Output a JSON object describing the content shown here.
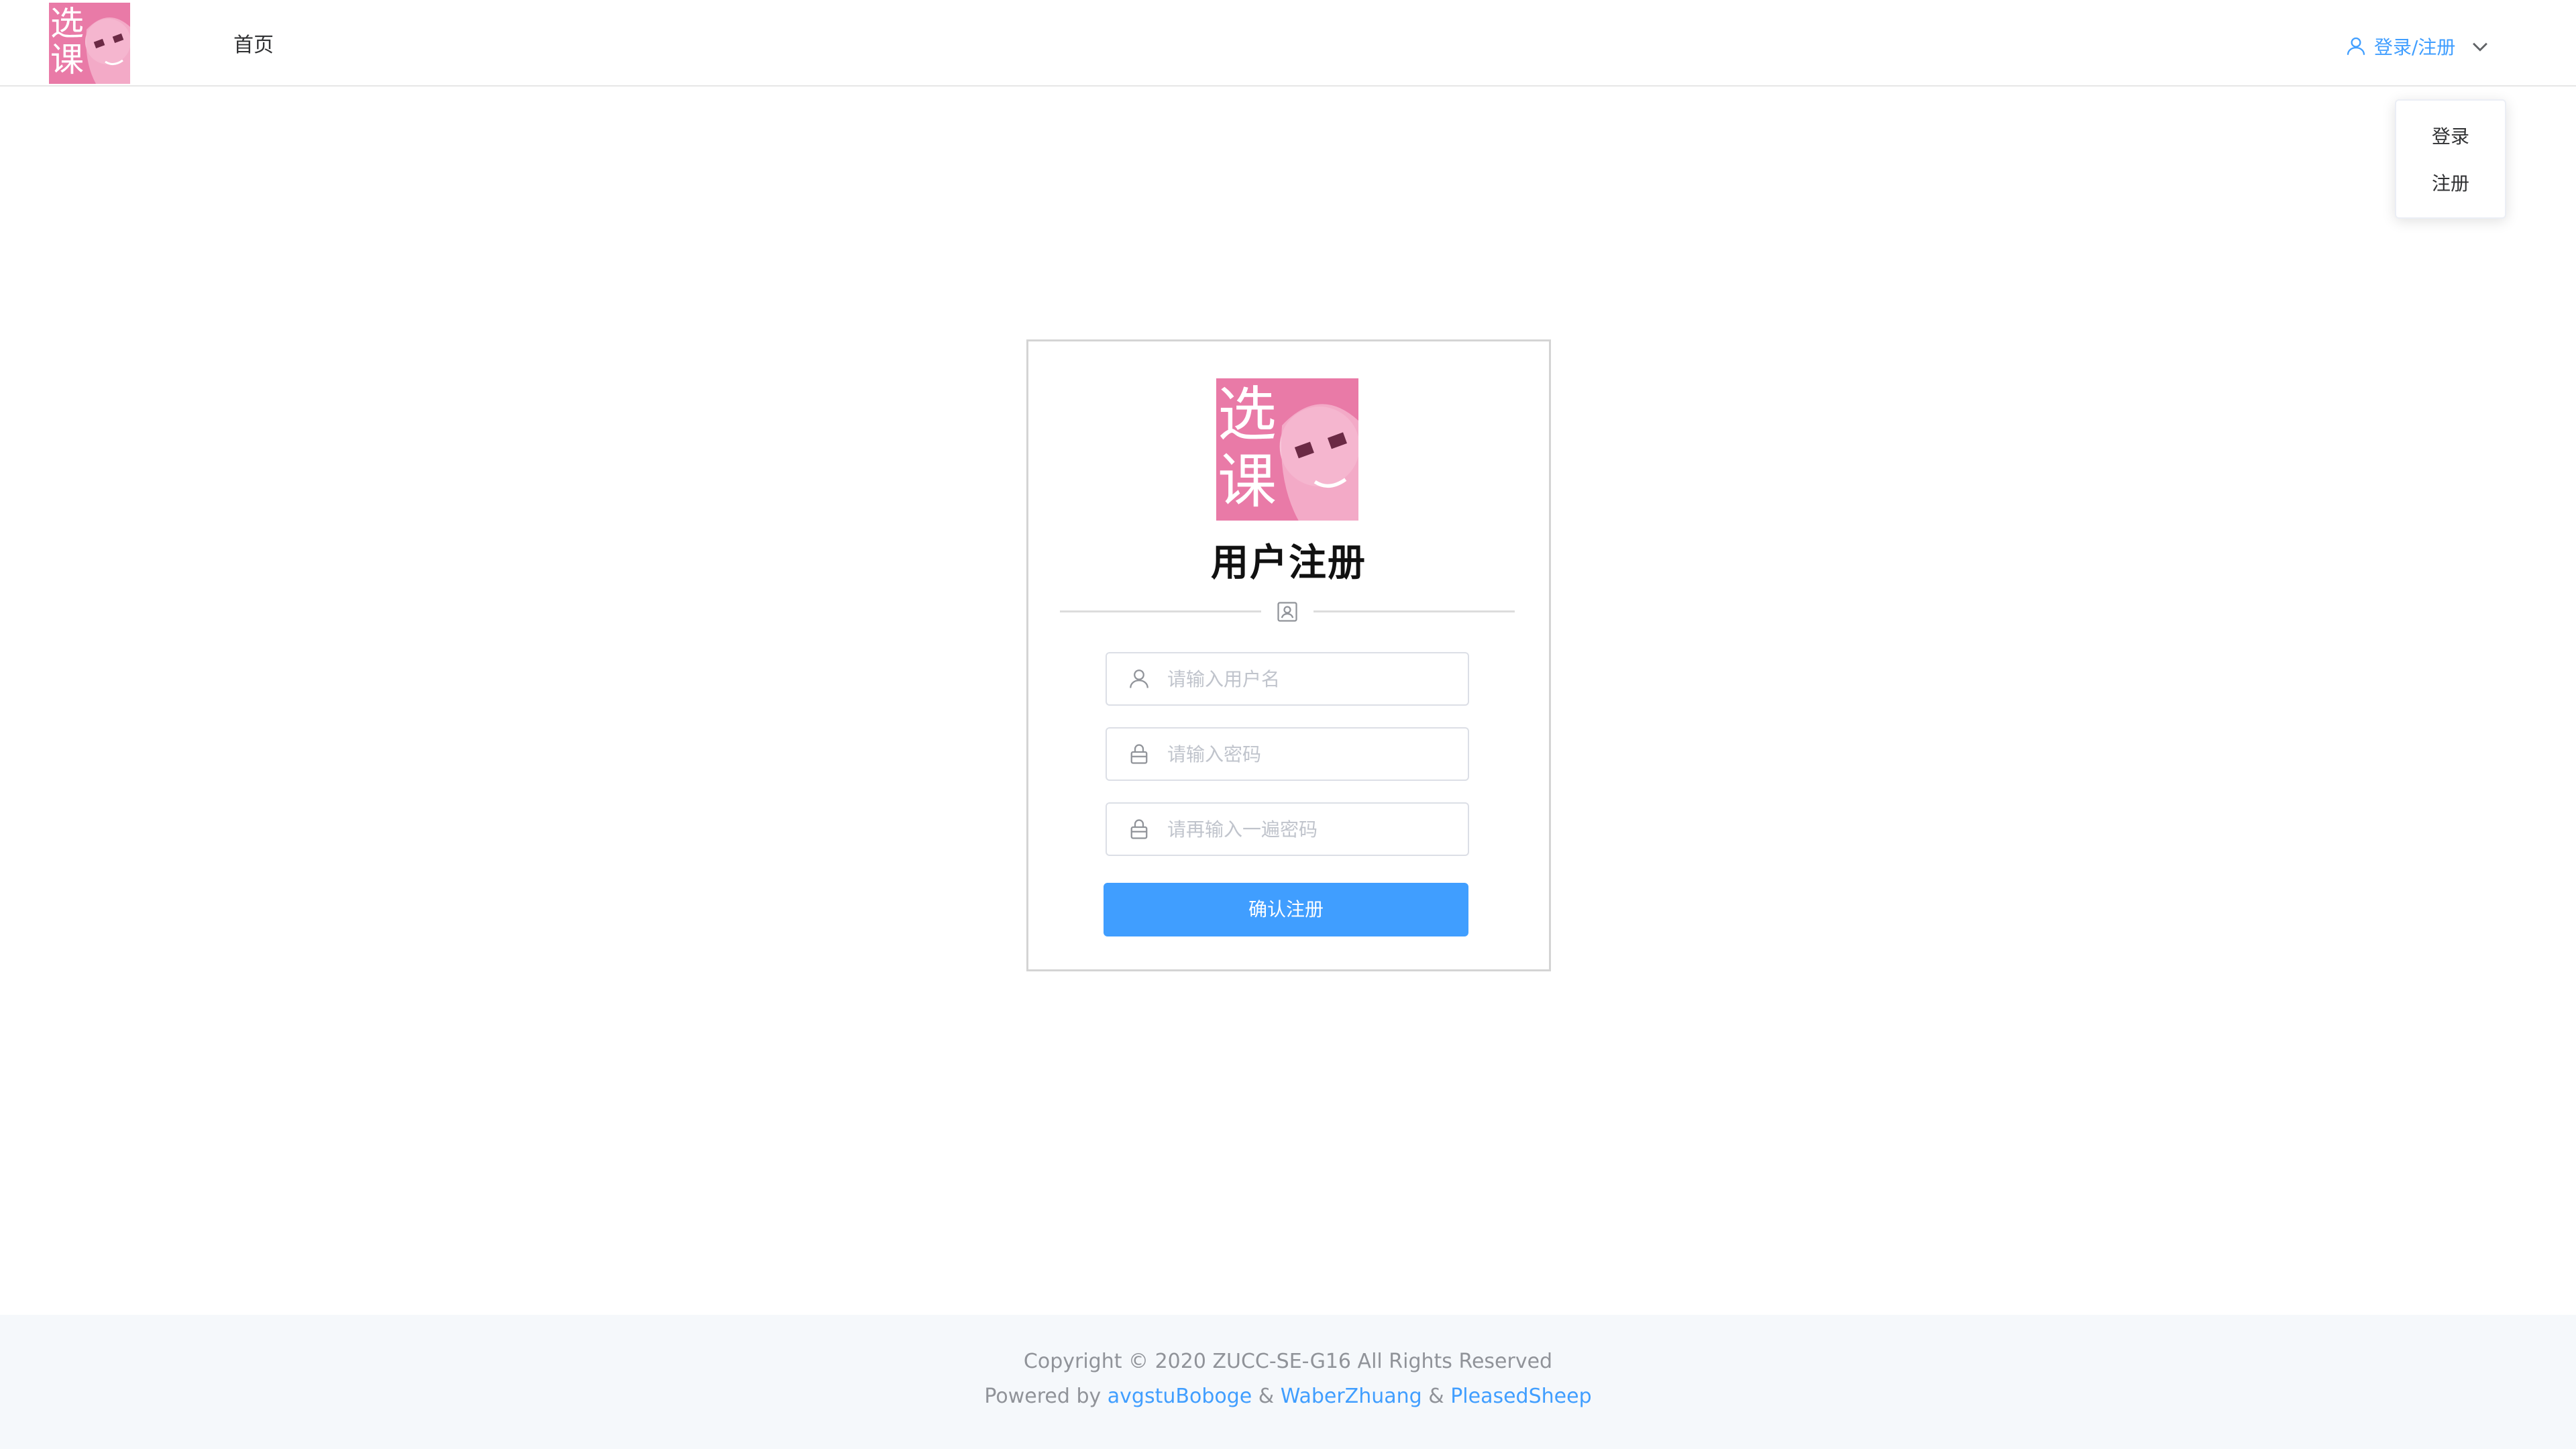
{
  "header": {
    "logo_chars": [
      "选",
      "课"
    ],
    "nav_home": "首页",
    "user_menu_label": "登录/注册",
    "accent_color": "#409eff"
  },
  "dropdown": {
    "items": [
      "登录",
      "注册"
    ]
  },
  "register": {
    "logo_chars": [
      "选",
      "课"
    ],
    "title": "用户注册",
    "username_placeholder": "请输入用户名",
    "password_placeholder": "请输入密码",
    "confirm_placeholder": "请再输入一遍密码",
    "submit_label": "确认注册",
    "icons": [
      "user-icon",
      "lock-icon",
      "lock-icon",
      "id-card-icon"
    ]
  },
  "footer": {
    "copyright": "Copyright © 2020 ZUCC-SE-G16 All Rights Reserved",
    "powered_prefix": "Powered by",
    "authors": [
      "avgstuBoboge",
      "WaberZhuang",
      "PleasedSheep"
    ],
    "separator": "&"
  },
  "colors": {
    "logo_bg": "#e97aa7",
    "footer_bg": "#f5f8fb",
    "button_bg": "#409eff"
  }
}
